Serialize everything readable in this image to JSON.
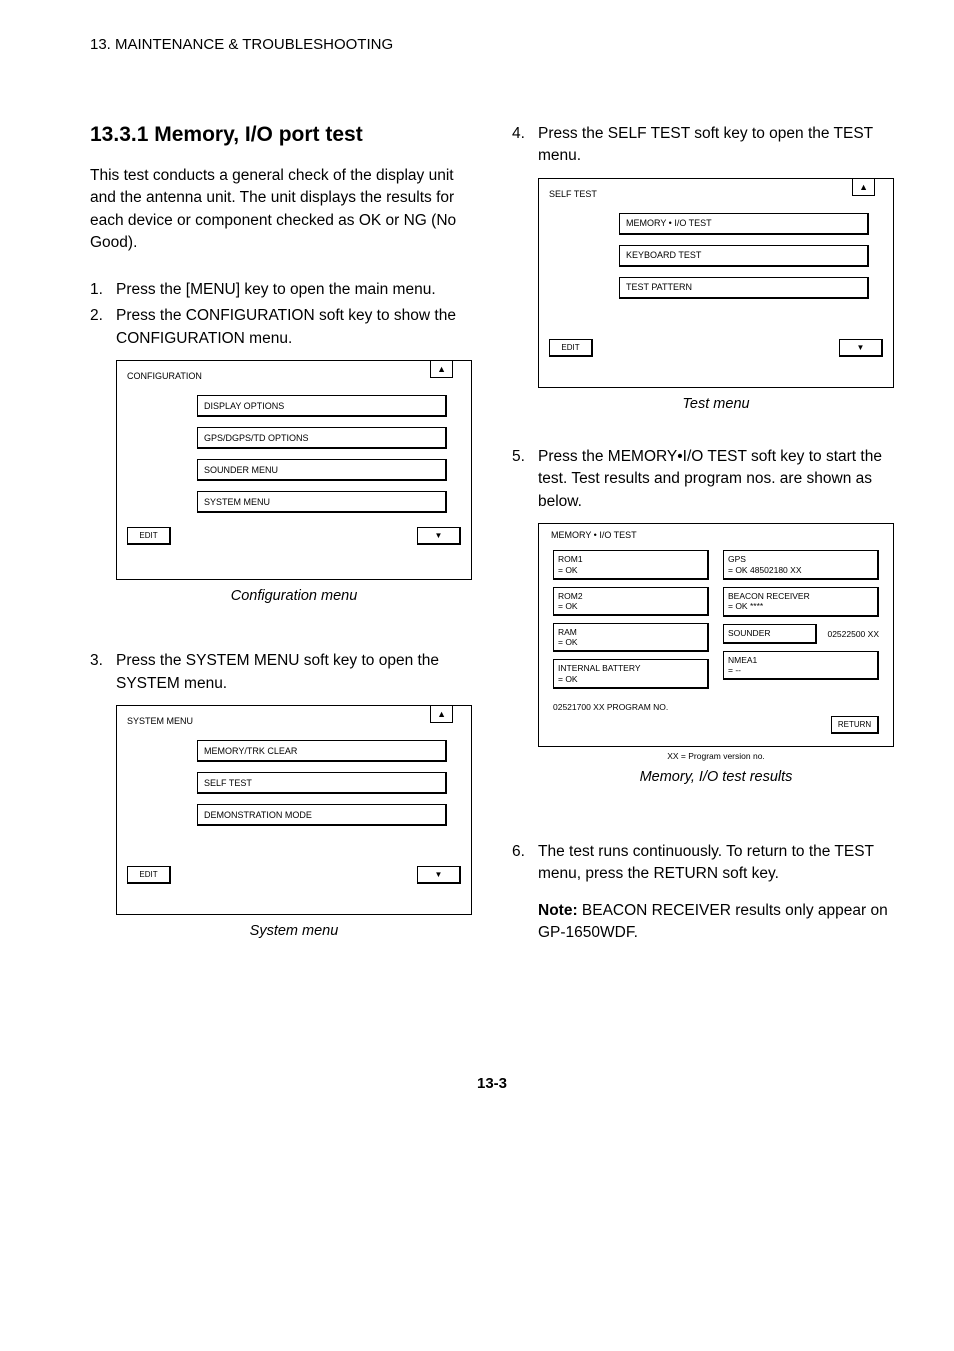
{
  "header": "13. MAINTENANCE & TROUBLESHOOTING",
  "section_number": "13.3.1",
  "section_title": "Memory, I/O port test",
  "intro": "This test conducts a general check of the display unit and the antenna unit. The unit displays the results for each device or component checked as OK or NG (No Good).",
  "steps": {
    "s1": "Press the [MENU] key to open the main menu.",
    "s2": "Press the CONFIGURATION soft key to show the CONFIGURATION menu.",
    "s3": "Press the SYSTEM MENU soft key to open the SYSTEM menu.",
    "s4": "Press the SELF TEST soft key to open the TEST menu.",
    "s5": "Press the MEMORY•I/O TEST soft key to start the test. Test results and program nos. are shown as below.",
    "s6": "The test runs continuously. To return to the TEST menu, press the RETURN soft key."
  },
  "figA": {
    "title": "CONFIGURATION",
    "tab": "▲",
    "keys": [
      "DISPLAY OPTIONS",
      "GPS/DGPS/TD OPTIONS",
      "SOUNDER MENU",
      "SYSTEM MENU"
    ],
    "left": "EDIT",
    "right": "▼",
    "caption": "Configuration menu"
  },
  "figB": {
    "title": "SYSTEM MENU",
    "tab": "▲",
    "keys": [
      "MEMORY/TRK CLEAR",
      "SELF TEST",
      "DEMONSTRATION MODE"
    ],
    "left": "EDIT",
    "right": "▼",
    "caption": "System menu"
  },
  "figC": {
    "title": "SELF TEST",
    "tab": "▲",
    "keys": [
      "MEMORY • I/O TEST",
      "KEYBOARD TEST",
      "TEST PATTERN"
    ],
    "left": "EDIT",
    "right": "▼",
    "caption": "Test menu"
  },
  "figD": {
    "title": "MEMORY • I/O TEST",
    "left_items": [
      {
        "label": "ROM1",
        "val": "= OK"
      },
      {
        "label": "ROM2",
        "val": "= OK"
      },
      {
        "label": "RAM",
        "val": "= OK"
      },
      {
        "label": "INTERNAL BATTERY",
        "val": "= OK"
      }
    ],
    "right_items": [
      {
        "label": "GPS",
        "val": "= OK     48502180 XX"
      },
      {
        "label": "BEACON RECEIVER",
        "val": "= OK     ****"
      },
      {
        "label": "SOUNDER",
        "tail": "02522500 XX"
      },
      {
        "label": "NMEA1",
        "val": "= --"
      }
    ],
    "progline": "02521700 XX    PROGRAM NO.",
    "brace": "XX = Program version no.",
    "ret": "RETURN",
    "caption": "Memory, I/O test results"
  },
  "note_label": "Note:",
  "note_text": " BEACON RECEIVER results only appear on GP-1650WDF.",
  "pagenum": "13-3"
}
